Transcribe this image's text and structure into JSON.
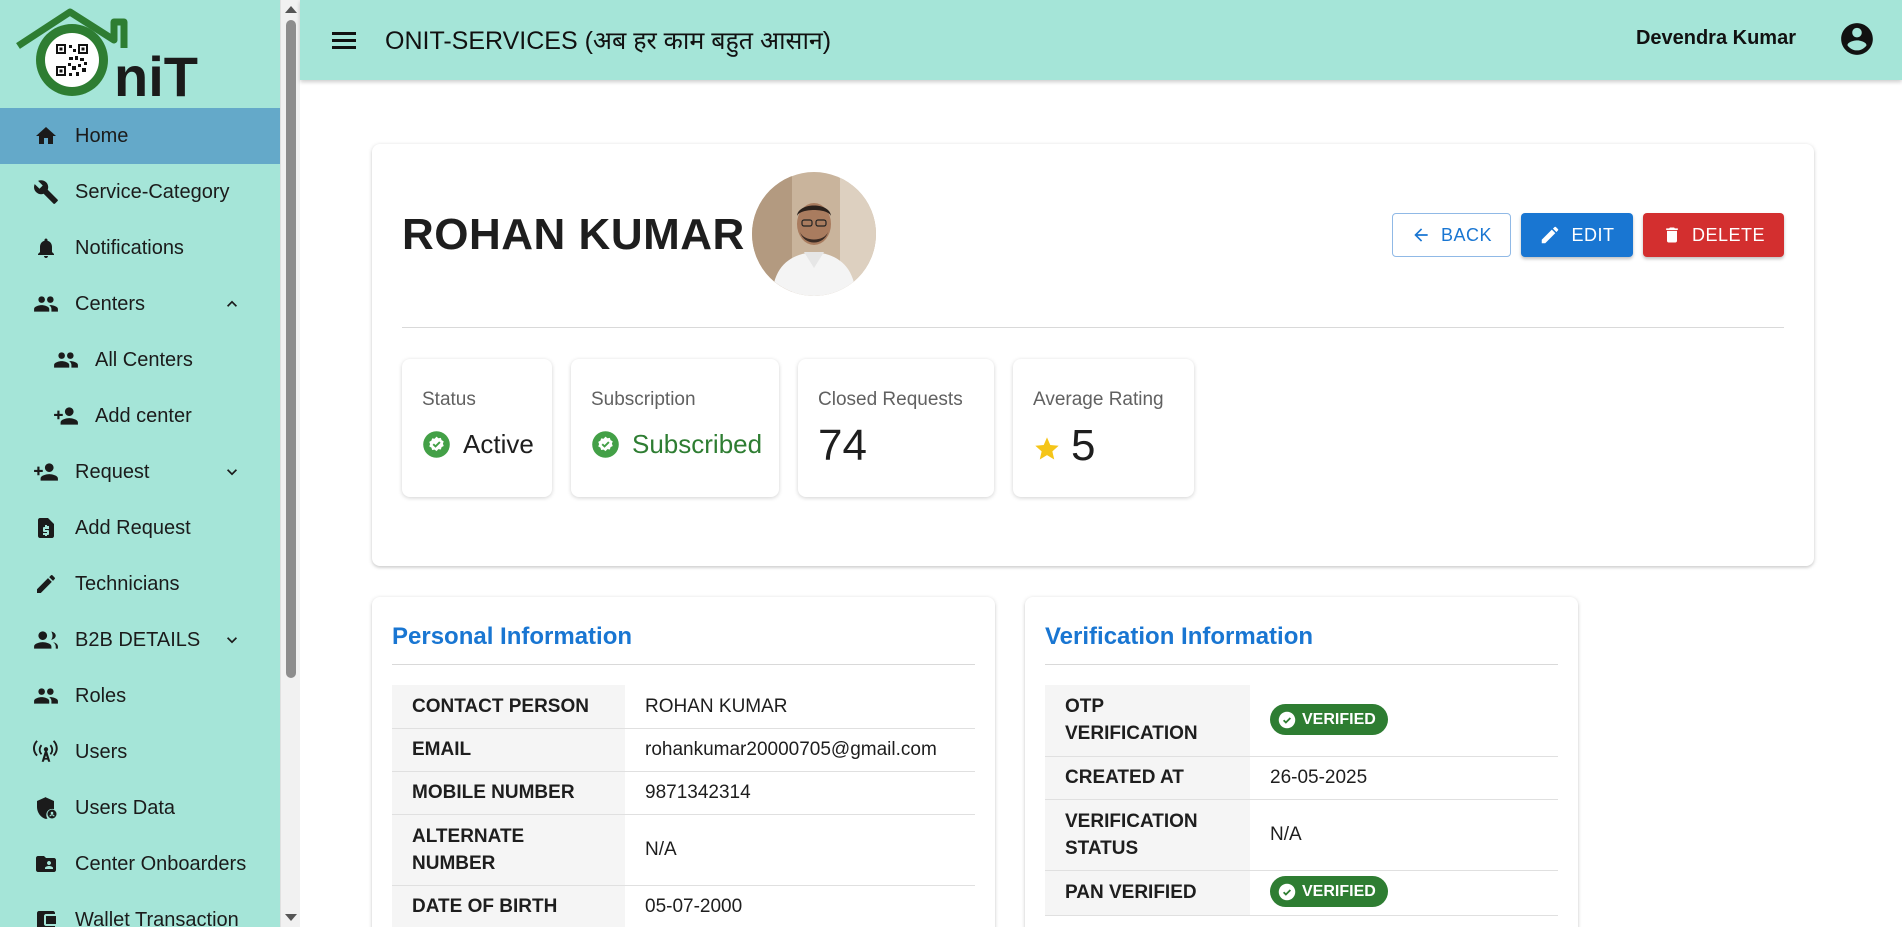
{
  "app": {
    "title": "ONIT-SERVICES (अब हर काम बहुत आसान)",
    "user_name": "Devendra Kumar",
    "logo_text": "niT"
  },
  "sidebar": {
    "items": [
      {
        "label": "Home",
        "icon": "home-icon",
        "active": true
      },
      {
        "label": "Service-Category",
        "icon": "wrench-icon"
      },
      {
        "label": "Notifications",
        "icon": "bell-icon"
      },
      {
        "label": "Centers",
        "icon": "people-icon",
        "expanded": true
      },
      {
        "label": "All Centers",
        "icon": "people-icon",
        "sub": true
      },
      {
        "label": "Add center",
        "icon": "person-add-icon",
        "sub": true
      },
      {
        "label": "Request",
        "icon": "person-add-icon",
        "expanded": false
      },
      {
        "label": "Add Request",
        "icon": "money-doc-icon"
      },
      {
        "label": "Technicians",
        "icon": "pencil-icon"
      },
      {
        "label": "B2B DETAILS",
        "icon": "people-icon",
        "expanded": false
      },
      {
        "label": "Roles",
        "icon": "people-icon"
      },
      {
        "label": "Users",
        "icon": "antenna-icon"
      },
      {
        "label": "Users Data",
        "icon": "shield-icon"
      },
      {
        "label": "Center Onboarders",
        "icon": "folder-user-icon"
      },
      {
        "label": "Wallet Transaction",
        "icon": "wallet-icon"
      }
    ]
  },
  "profile": {
    "name": "ROHAN KUMAR",
    "buttons": {
      "back": "BACK",
      "edit": "EDIT",
      "delete": "DELETE"
    },
    "stats": {
      "status_label": "Status",
      "status_value": "Active",
      "subscription_label": "Subscription",
      "subscription_value": "Subscribed",
      "closed_label": "Closed Requests",
      "closed_value": "74",
      "rating_label": "Average Rating",
      "rating_value": "5"
    }
  },
  "personal": {
    "title": "Personal Information",
    "rows": [
      {
        "key": "CONTACT PERSON",
        "value": "ROHAN KUMAR"
      },
      {
        "key": "EMAIL",
        "value": "rohankumar20000705@gmail.com"
      },
      {
        "key": "MOBILE NUMBER",
        "value": "9871342314"
      },
      {
        "key": "ALTERNATE NUMBER",
        "value": "N/A"
      },
      {
        "key": "DATE OF BIRTH",
        "value": "05-07-2000"
      }
    ]
  },
  "verification": {
    "title": "Verification Information",
    "rows": [
      {
        "key": "OTP VERIFICATION",
        "badge": "VERIFIED"
      },
      {
        "key": "CREATED AT",
        "value": "26-05-2025"
      },
      {
        "key": "VERIFICATION STATUS",
        "value": "N/A"
      },
      {
        "key": "PAN VERIFIED",
        "badge": "VERIFIED"
      }
    ]
  },
  "colors": {
    "teal": "#a5e5d8",
    "active_nav": "#64a9c9",
    "primary": "#1976d2",
    "danger": "#d32f2f",
    "success": "#43a047",
    "badge": "#2e7d32",
    "star": "#f5c518"
  }
}
